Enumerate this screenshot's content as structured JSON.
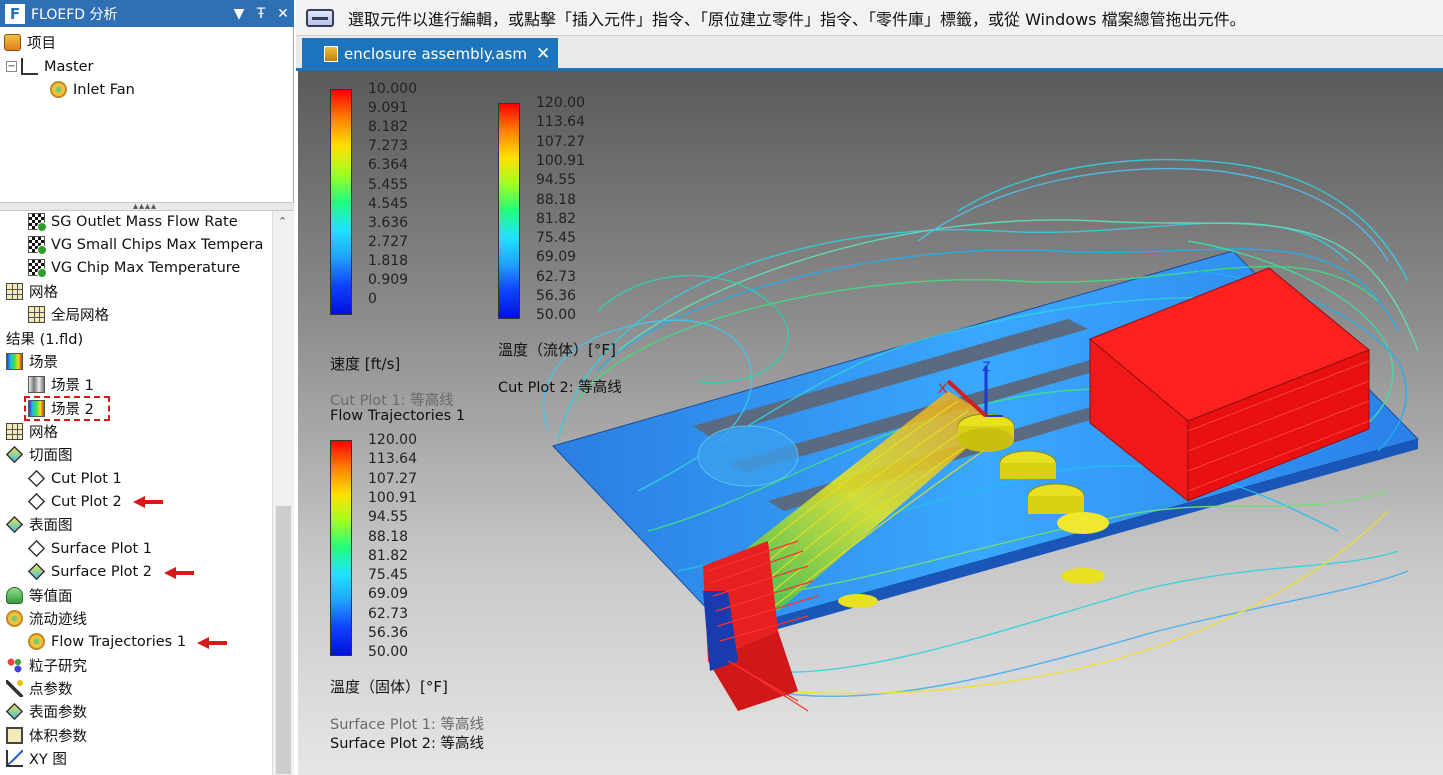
{
  "panel": {
    "title": "FLOEFD 分析",
    "logo": "F",
    "buttons": {
      "dropdown": "▼",
      "pin": "Ŧ",
      "close": "✕"
    }
  },
  "top_tree": [
    {
      "label": "项目",
      "icon": "project-icon"
    },
    {
      "label": "Master",
      "icon": "master-icon"
    },
    {
      "label": "Inlet Fan",
      "icon": "fan-icon"
    }
  ],
  "goals": [
    {
      "label": "SG Outlet Mass Flow Rate",
      "icon": "goal-flag-icon"
    },
    {
      "label": "VG Small Chips Max Tempera",
      "icon": "goal-flag-icon"
    },
    {
      "label": "VG Chip Max Temperature",
      "icon": "goal-flag-icon"
    }
  ],
  "tree": {
    "mesh": "网格",
    "global_mesh": "全局网格",
    "results": "结果 (1.fld)",
    "scenes": "场景",
    "scene1": "场景 1",
    "scene2": "场景 2",
    "mesh2": "网格",
    "cut_plots": "切面图",
    "cut_plot1": "Cut Plot 1",
    "cut_plot2": "Cut Plot 2",
    "surface_plots": "表面图",
    "surface_plot1": "Surface Plot 1",
    "surface_plot2": "Surface Plot 2",
    "isosurfaces": "等值面",
    "flow_traj": "流动迹线",
    "flow_traj1": "Flow Trajectories 1",
    "particle": "粒子研究",
    "point_params": "点参数",
    "surface_params": "表面参数",
    "volume_params": "体积参数",
    "xy_plot": "XY 图"
  },
  "status_message": "選取元件以進行編輯，或點擊「插入元件」指令、「原位建立零件」指令、「零件庫」標籤，或從 Windows 檔案總管拖出元件。",
  "document_tab": {
    "name": "enclosure assembly.asm",
    "close": "✕"
  },
  "axes": {
    "x": "X",
    "z": "Z"
  },
  "legends": {
    "velocity": {
      "ticks": [
        "10.000",
        "9.091",
        "8.182",
        "7.273",
        "6.364",
        "5.455",
        "4.545",
        "3.636",
        "2.727",
        "1.818",
        "0.909",
        "0"
      ],
      "label": "速度 [ft/s]",
      "sub1": "Cut Plot 1: 等高线",
      "sub2": "Flow Trajectories 1"
    },
    "fluid_temp": {
      "ticks": [
        "120.00",
        "113.64",
        "107.27",
        "100.91",
        "94.55",
        "88.18",
        "81.82",
        "75.45",
        "69.09",
        "62.73",
        "56.36",
        "50.00"
      ],
      "label": "溫度（流体）[°F]",
      "sub1": "Cut Plot 2: 等高线"
    },
    "solid_temp": {
      "ticks": [
        "120.00",
        "113.64",
        "107.27",
        "100.91",
        "94.55",
        "88.18",
        "81.82",
        "75.45",
        "69.09",
        "62.73",
        "56.36",
        "50.00"
      ],
      "label": "溫度（固体）[°F]",
      "sub1": "Surface Plot 1: 等高线",
      "sub2": "Surface Plot 2: 等高线"
    }
  },
  "colors": {
    "accent": "#1c75bc",
    "title_bar": "#2f6fb4",
    "highlight_red": "#d81818",
    "heat_block": "#e81010"
  }
}
